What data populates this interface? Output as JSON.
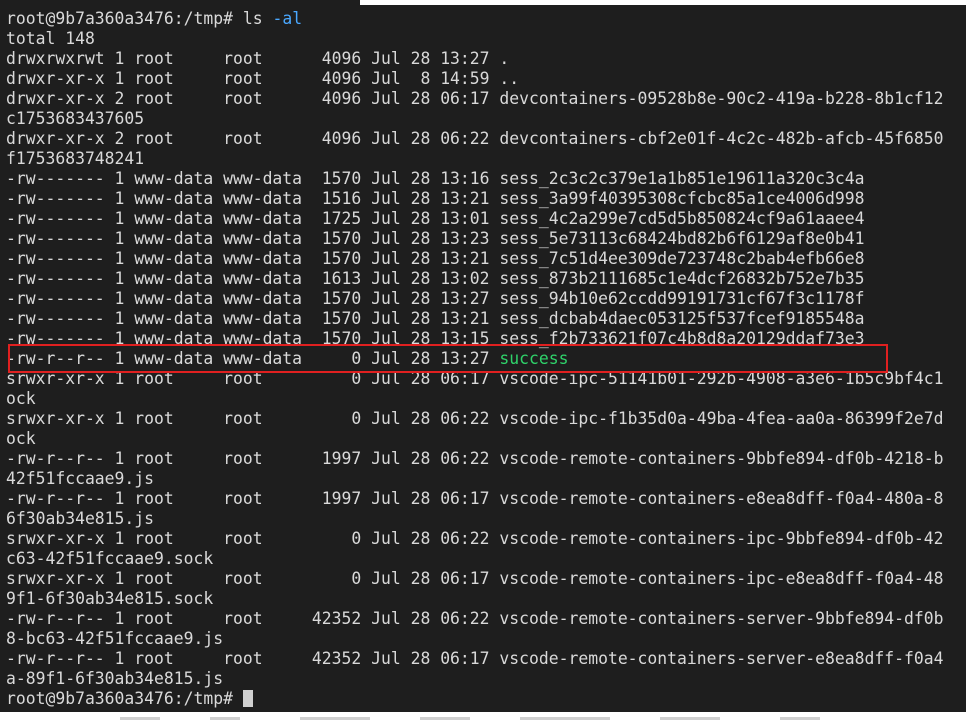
{
  "terminal": {
    "prompt": "root@9b7a360a3476:/tmp#",
    "command": "ls",
    "command_flag": "-al",
    "total": "total 148",
    "lines": [
      "drwxrwxrwt 1 root     root      4096 Jul 28 13:27 .",
      "drwxr-xr-x 1 root     root      4096 Jul  8 14:59 ..",
      "drwxr-xr-x 2 root     root      4096 Jul 28 06:17 devcontainers-09528b8e-90c2-419a-b228-8b1cf12",
      "c1753683437605",
      "drwxr-xr-x 2 root     root      4096 Jul 28 06:22 devcontainers-cbf2e01f-4c2c-482b-afcb-45f6850",
      "f1753683748241",
      "-rw------- 1 www-data www-data  1570 Jul 28 13:16 sess_2c3c2c379e1a1b851e19611a320c3c4a",
      "-rw------- 1 www-data www-data  1516 Jul 28 13:21 sess_3a99f40395308cfcbc85a1ce4006d998",
      "-rw------- 1 www-data www-data  1725 Jul 28 13:01 sess_4c2a299e7cd5d5b850824cf9a61aaee4",
      "-rw------- 1 www-data www-data  1570 Jul 28 13:23 sess_5e73113c68424bd82b6f6129af8e0b41",
      "-rw------- 1 www-data www-data  1570 Jul 28 13:21 sess_7c51d4ee309de723748c2bab4efb66e8",
      "-rw------- 1 www-data www-data  1613 Jul 28 13:02 sess_873b2111685c1e4dcf26832b752e7b35",
      "-rw------- 1 www-data www-data  1570 Jul 28 13:27 sess_94b10e62ccdd99191731cf67f3c1178f",
      "-rw------- 1 www-data www-data  1570 Jul 28 13:21 sess_dcbab4daec053125f537fcef9185548a",
      "-rw------- 1 www-data www-data  1570 Jul 28 13:15 sess_f2b733621f07c4b8d8a20129ddaf73e3"
    ],
    "success_line_prefix": "-rw-r--r-- 1 www-data www-data     0 Jul 28 13:27 ",
    "success_name": "success",
    "lines_after": [
      "srwxr-xr-x 1 root     root         0 Jul 28 06:17 vscode-ipc-51141b01-292b-4908-a3e6-1b5c9bf4c1",
      "ock",
      "srwxr-xr-x 1 root     root         0 Jul 28 06:22 vscode-ipc-f1b35d0a-49ba-4fea-aa0a-86399f2e7d",
      "ock",
      "-rw-r--r-- 1 root     root      1997 Jul 28 06:22 vscode-remote-containers-9bbfe894-df0b-4218-b",
      "42f51fccaae9.js",
      "-rw-r--r-- 1 root     root      1997 Jul 28 06:17 vscode-remote-containers-e8ea8dff-f0a4-480a-8",
      "6f30ab34e815.js",
      "srwxr-xr-x 1 root     root         0 Jul 28 06:22 vscode-remote-containers-ipc-9bbfe894-df0b-42",
      "c63-42f51fccaae9.sock",
      "srwxr-xr-x 1 root     root         0 Jul 28 06:17 vscode-remote-containers-ipc-e8ea8dff-f0a4-48",
      "9f1-6f30ab34e815.sock",
      "-rw-r--r-- 1 root     root     42352 Jul 28 06:22 vscode-remote-containers-server-9bbfe894-df0b",
      "8-bc63-42f51fccaae9.js",
      "-rw-r--r-- 1 root     root     42352 Jul 28 06:17 vscode-remote-containers-server-e8ea8dff-f0a4",
      "a-89f1-6f30ab34e815.js"
    ],
    "final_prompt": "root@9b7a360a3476:/tmp#"
  },
  "colors": {
    "background": "#1e1e1e",
    "text": "#d9d9d9",
    "command": "#4aa8ff",
    "success": "#2fd26a",
    "highlight_border": "#e02020"
  }
}
